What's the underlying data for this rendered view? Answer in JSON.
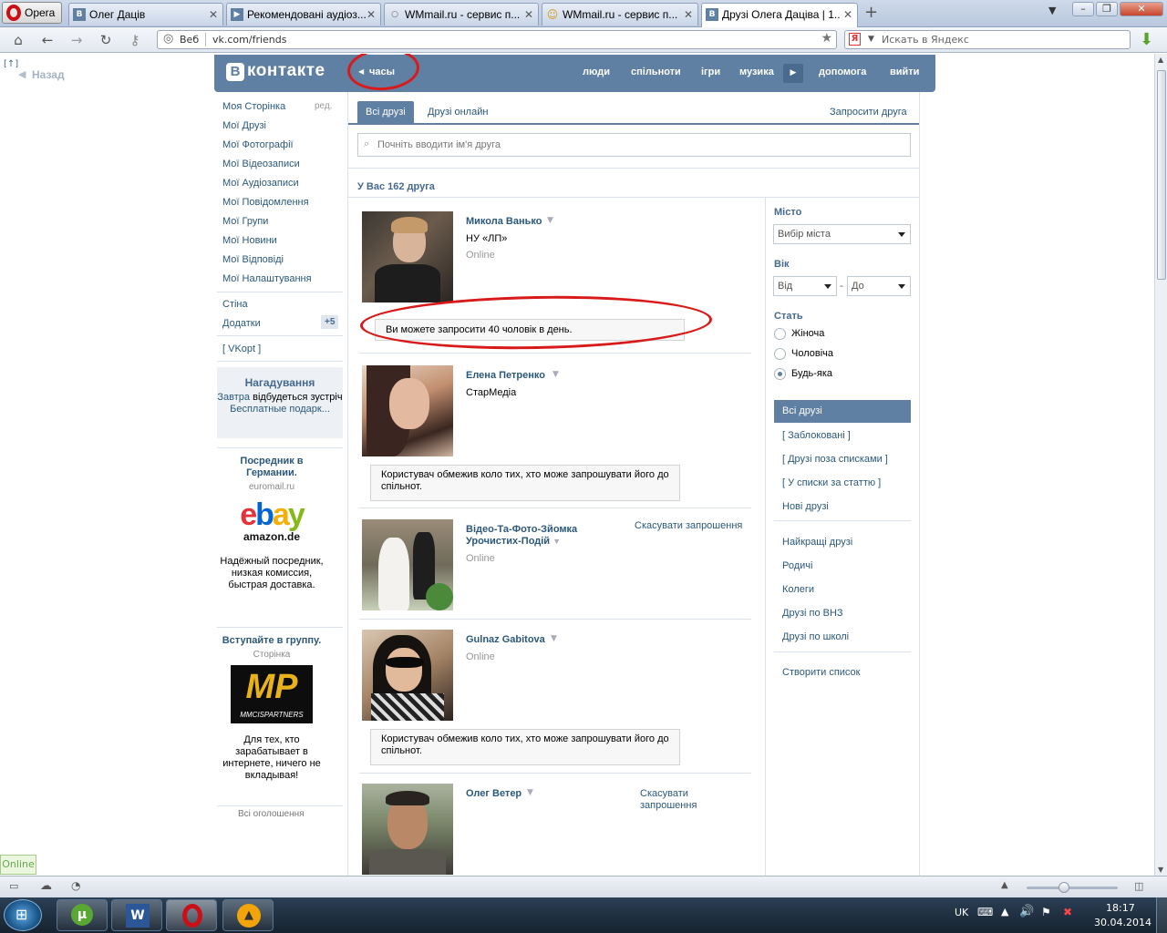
{
  "browser": {
    "opera_label": "Opera",
    "tabs": [
      {
        "title": "Олег Даців",
        "icon": "B"
      },
      {
        "title": "Рекомендовані аудіоз...",
        "icon": "▶"
      },
      {
        "title": "WMmail.ru - сервис п...",
        "icon": "○"
      },
      {
        "title": "WMmail.ru - сервис п...",
        "icon": "☺"
      },
      {
        "title": "Друзі Олега Даціва | 1...",
        "icon": "B"
      }
    ],
    "new_tab": "+",
    "address_prefix": "Веб",
    "url": "vk.com/friends",
    "search_placeholder": "Искать в Яндекс",
    "search_badge": "Я"
  },
  "sidebar_left": {
    "up": "[↑]",
    "back": "Назад"
  },
  "vk_header": {
    "logo_letter": "В",
    "title": "контакте",
    "time_link": "часы",
    "nav": [
      "люди",
      "спільноти",
      "ігри",
      "музика",
      "допомога",
      "вийти"
    ]
  },
  "left_menu": {
    "items": [
      "Моя Сторінка",
      "Мої Друзі",
      "Мої Фотографії",
      "Мої Відеозаписи",
      "Мої Аудіозаписи",
      "Мої Повідомлення",
      "Мої Групи",
      "Мої Новини",
      "Мої Відповіді",
      "Мої Налаштування"
    ],
    "edit": "ред.",
    "wall": "Стіна",
    "apps": "Додатки",
    "apps_badge": "+5",
    "vkopt": "[ VKopt ]",
    "reminder_title": "Нагадування",
    "reminder_part1": "Завтра",
    "reminder_part2": " відбудеться зустріч ",
    "reminder_link": "Бесплатные подарк...",
    "ad1_title": "Посредник в Германии.",
    "ad1_domain": "euromail.ru",
    "ad1_text": "Надёжный посредник, низкая комиссия, быстрая доставка.",
    "ad1_logo_top": "ebay",
    "ad1_logo_bottom": "amazon.de",
    "ad2_title": "Вступайте в группу.",
    "ad2_domain": "Сторінка",
    "ad2_logo": "MP",
    "ad2_logo_sub": "MMCISPARTNERS",
    "ad2_text": "Для тех, кто зарабатывает в интернете, ничего не вкладывая!",
    "all_ads": "Всі оголошення"
  },
  "friends_page": {
    "tab_all": "Всі друзі",
    "tab_online": "Друзі онлайн",
    "invite": "Запросити друга",
    "search_placeholder": "Почніть вводити ім'я друга",
    "count": "У Вас 162 друга",
    "friends": [
      {
        "name": "Микола Ванько",
        "sub": "НУ «ЛП»",
        "status": "Online",
        "notice": "Ви можете запросити 40 чоловік в день."
      },
      {
        "name": "Елена Петренко",
        "sub": "СтарМедіа",
        "notice": "Користувач обмежив коло тих, хто може запрошувати його до спільнот."
      },
      {
        "name": "Відео-Та-Фото-Зйомка Урочистих-Подій",
        "status": "Online",
        "action": "Скасувати запрошення"
      },
      {
        "name": "Gulnaz Gabitova",
        "status": "Online",
        "notice": "Користувач обмежив коло тих, хто може запрошувати його до спільнот."
      },
      {
        "name": "Олег Ветер",
        "action": "Скасувати запрошення"
      }
    ]
  },
  "filters": {
    "city_label": "Місто",
    "city_value": "Вибір міста",
    "age_label": "Вік",
    "age_from": "Від",
    "age_dash": "-",
    "age_to": "До",
    "sex_label": "Стать",
    "sex_options": [
      "Жіноча",
      "Чоловіча",
      "Будь-яка"
    ],
    "sex_selected": "Будь-яка",
    "lists": [
      "Всі друзі",
      "[ Заблоковані ]",
      "[ Друзі поза списками ]",
      "[ У списки за статтю ]",
      "Нові друзі",
      "Найкращі друзі",
      "Родичі",
      "Колеги",
      "Друзі по ВНЗ",
      "Друзі по школі",
      "Створити список"
    ],
    "lists_selected": "Всі друзі"
  },
  "status": {
    "online_badge": "Online"
  },
  "taskbar": {
    "lang": "UK",
    "time": "18:17",
    "date": "30.04.2014"
  },
  "colors": {
    "vk_blue": "#5f7fa3",
    "link": "#2b587a",
    "annotation_red": "#d91a1a"
  }
}
